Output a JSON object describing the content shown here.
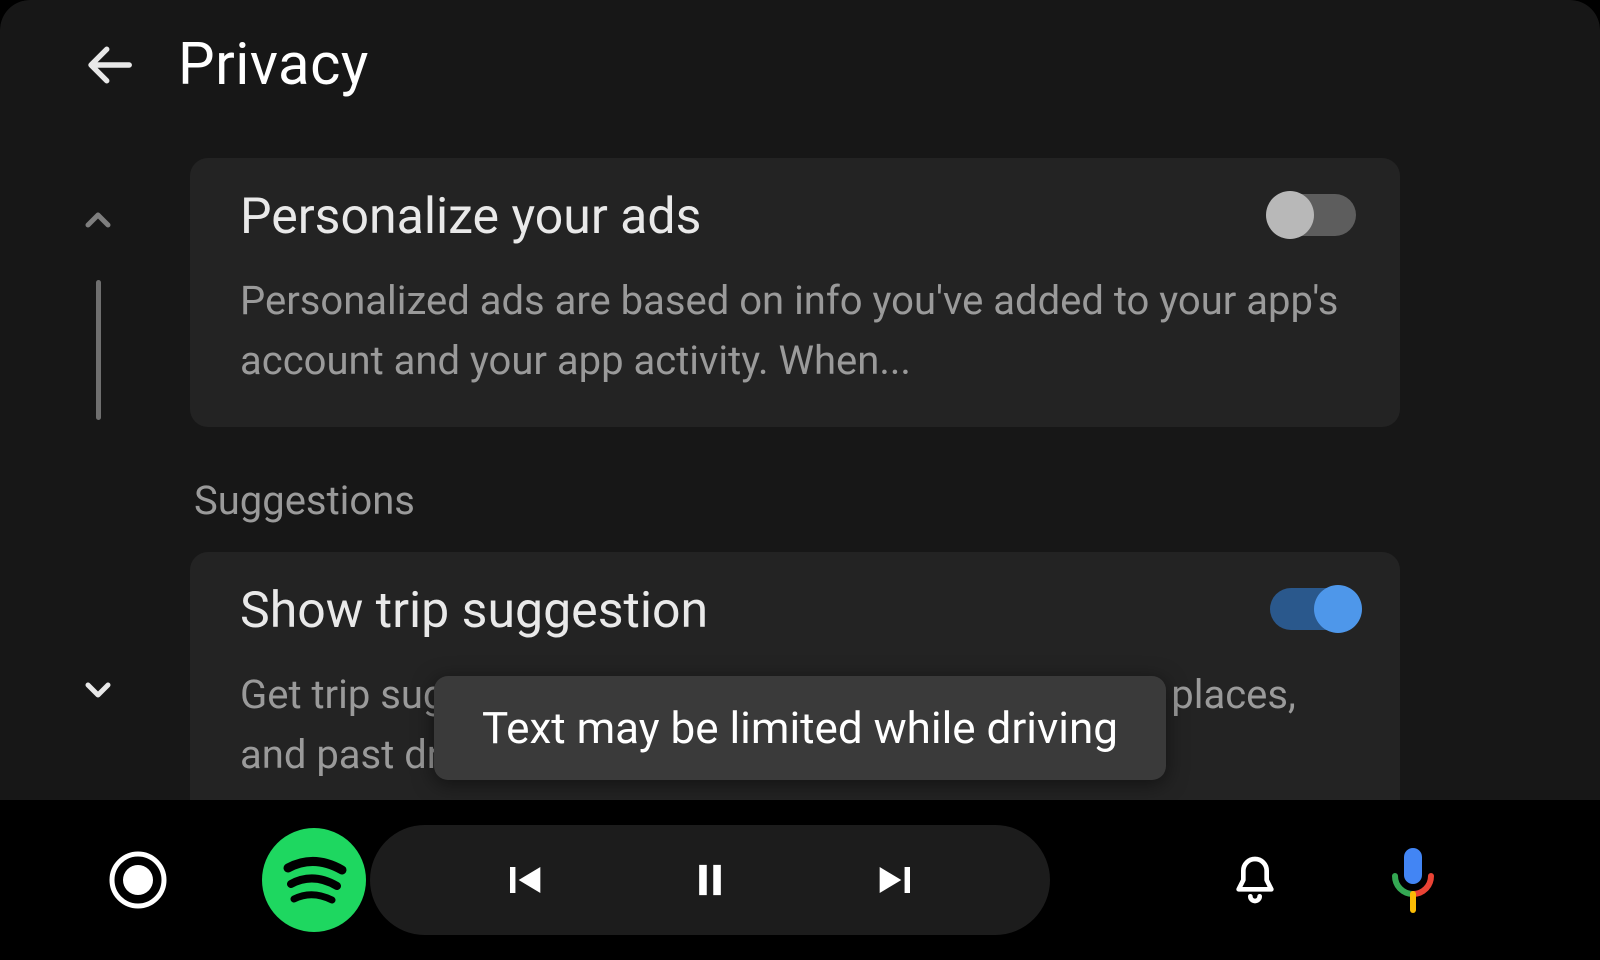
{
  "header": {
    "title": "Privacy"
  },
  "settings": {
    "personalizeAds": {
      "title": "Personalize your ads",
      "subtitle": "Personalized ads are based on info you've added to your app's account and your app activity. When...",
      "enabled": false
    },
    "suggestionsSection": "Suggestions",
    "tripSuggestion": {
      "title": "Show trip suggestion",
      "subtitle": "Get trip suggestions based on your commute, saved places, and past drives",
      "enabled": true
    }
  },
  "toast": {
    "message": "Text may be limited while driving"
  },
  "colors": {
    "accentOn": "#4e97ea",
    "trackOn": "#2a588c",
    "spotifyGreen": "#1ed760"
  }
}
